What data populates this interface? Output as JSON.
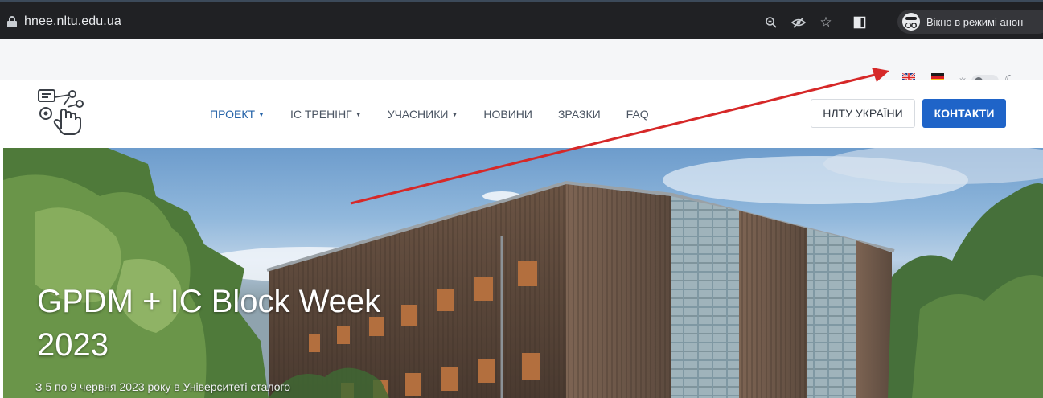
{
  "browser": {
    "url": "hnee.nltu.edu.ua",
    "incognito_label": "Вікно в режимі анон",
    "icons": [
      "lock-icon",
      "zoom-icon",
      "eye-off-icon",
      "star-icon",
      "sidebar-icon",
      "incognito-icon"
    ]
  },
  "utility": {
    "languages": [
      "English (flag-uk-icon)",
      "Deutsch (flag-de-icon)"
    ],
    "theme_icons": [
      "sun-icon",
      "moon-icon"
    ],
    "theme_toggle": "light"
  },
  "nav": {
    "items": [
      {
        "label": "ПРОЕКТ",
        "dropdown": true,
        "active": true
      },
      {
        "label": "ІС ТРЕНІНГ",
        "dropdown": true,
        "active": false
      },
      {
        "label": "УЧАСНИКИ",
        "dropdown": true,
        "active": false
      },
      {
        "label": "НОВИНИ",
        "dropdown": false,
        "active": false
      },
      {
        "label": "ЗРАЗКИ",
        "dropdown": false,
        "active": false
      },
      {
        "label": "FAQ",
        "dropdown": false,
        "active": false
      }
    ],
    "outline_button": "НЛТУ УКРАЇНИ",
    "primary_button": "КОНТАКТИ"
  },
  "hero": {
    "title": "GPDM + IC Block Week 2023",
    "subtitle": "З 5 по 9 червня 2023 року в Університеті сталого"
  },
  "colors": {
    "browser_bg": "#202124",
    "accent": "#1f64c8",
    "active_nav": "#2563a8",
    "annotation_arrow": "#d62828"
  }
}
